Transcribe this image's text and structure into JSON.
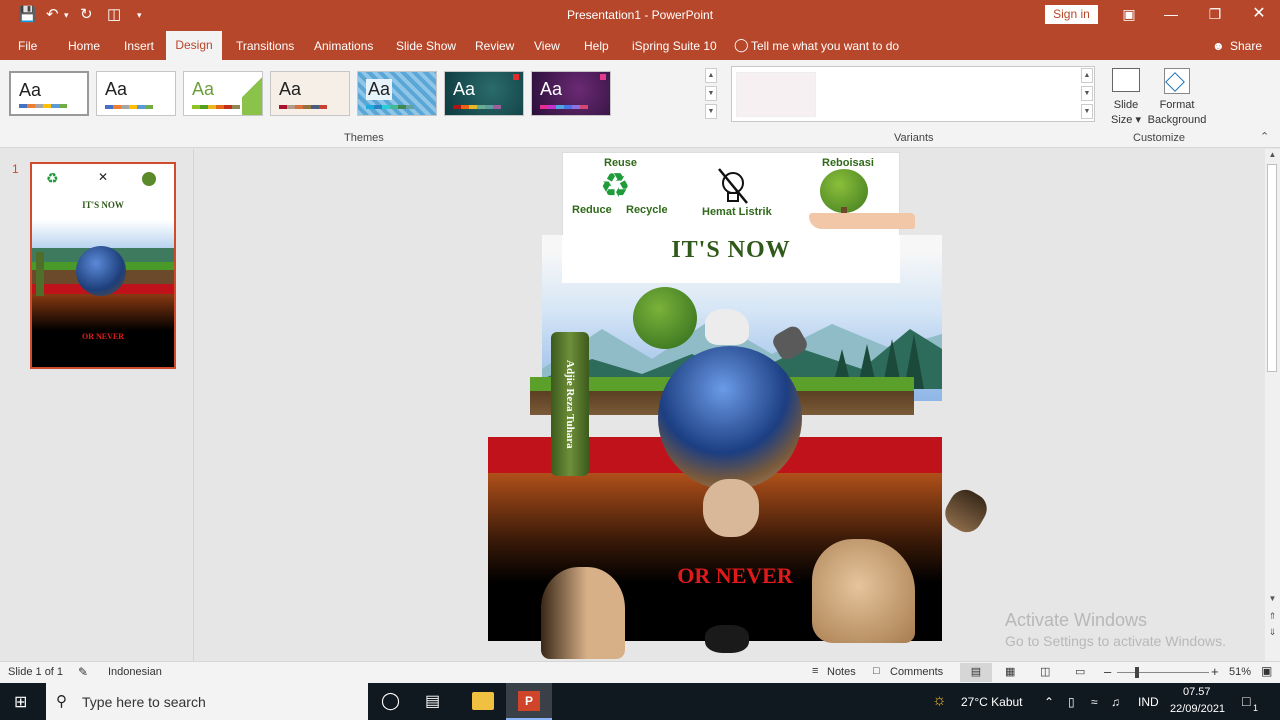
{
  "window": {
    "title": "Presentation1  -  PowerPoint",
    "sign_in": "Sign in"
  },
  "tabs": [
    "File",
    "Home",
    "Insert",
    "Design",
    "Transitions",
    "Animations",
    "Slide Show",
    "Review",
    "View",
    "Help",
    "iSpring Suite 10"
  ],
  "tell_me": "Tell me what you want to do",
  "share": "Share",
  "ribbon": {
    "themes_label": "Themes",
    "variants_label": "Variants",
    "customize_label": "Customize",
    "theme_sample_text": "Aa",
    "slide_size_label": "Slide\nSize",
    "slide_size_line1": "Slide",
    "slide_size_line2": "Size",
    "format_bg_line1": "Format",
    "format_bg_line2": "Background"
  },
  "slide_panel": {
    "slide_number": "1"
  },
  "slide": {
    "reuse": "Reuse",
    "reduce": "Reduce",
    "recycle": "Recycle",
    "hemat_listrik": "Hemat Listrik",
    "reboisasi": "Reboisasi",
    "its_now": "IT'S NOW",
    "or_never": "OR NEVER",
    "author": "Adjie Reza Tuhara"
  },
  "watermark": {
    "line1": "Activate Windows",
    "line2": "Go to Settings to activate Windows."
  },
  "statusbar": {
    "slide_of": "Slide 1 of 1",
    "language": "Indonesian",
    "notes": "Notes",
    "comments": "Comments",
    "zoom": "51%"
  },
  "taskbar": {
    "search_placeholder": "Type here to search",
    "weather": "27°C  Kabut",
    "lang": "IND",
    "time": "07.57",
    "date": "22/09/2021",
    "notif_count": "1"
  },
  "colors": {
    "accent": "#b7472a",
    "slide_red": "#c0121a",
    "title_green": "#2f5a1a"
  }
}
